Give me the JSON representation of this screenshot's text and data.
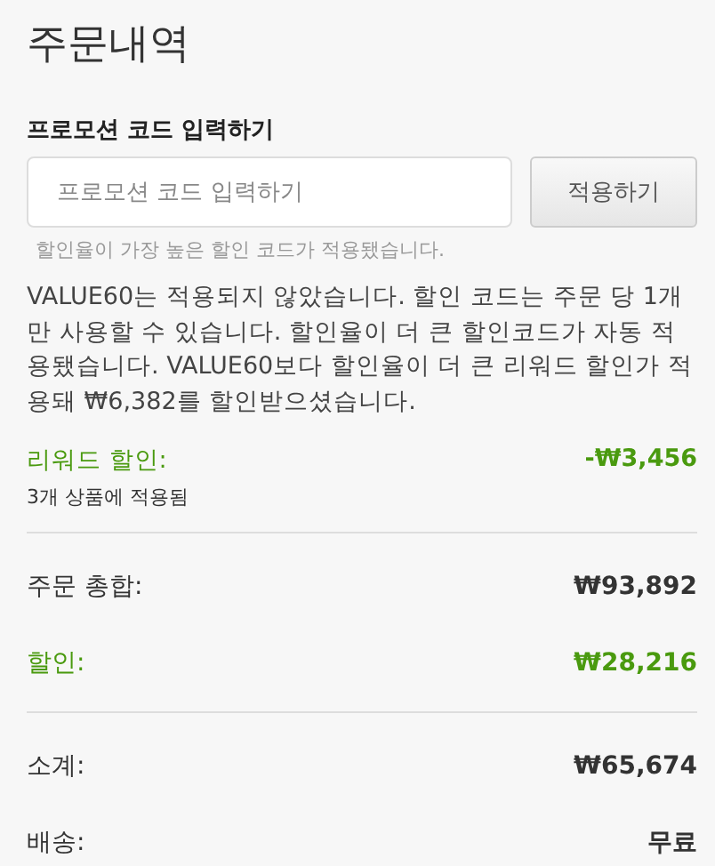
{
  "title": "주문내역",
  "promo": {
    "label": "프로모션 코드 입력하기",
    "placeholder": "프로모션 코드 입력하기",
    "button": "적용하기",
    "hint": "할인율이 가장 높은 할인 코드가 적용됐습니다."
  },
  "message": "VALUE60는 적용되지 않았습니다. 할인 코드는 주문 당 1개만 사용할 수 있습니다. 할인율이 더 큰 할인코드가 자동 적용됐습니다. VALUE60보다 할인율이 더 큰 리워드 할인가 적용돼 ₩6,382를 할인받으셨습니다.",
  "reward": {
    "label": "리워드 할인:",
    "amount": "-₩3,456",
    "note": "3개 상품에 적용됨"
  },
  "sections": [
    {
      "rows": [
        {
          "kind": "normal",
          "label": "주문 총합:",
          "value": "₩93,892"
        },
        {
          "kind": "discount",
          "label": "할인:",
          "value": "₩28,216"
        }
      ]
    },
    {
      "rows": [
        {
          "kind": "normal",
          "label": "소계:",
          "value": "₩65,674"
        },
        {
          "kind": "normal",
          "label": "배송:",
          "value": "무료"
        }
      ]
    }
  ]
}
